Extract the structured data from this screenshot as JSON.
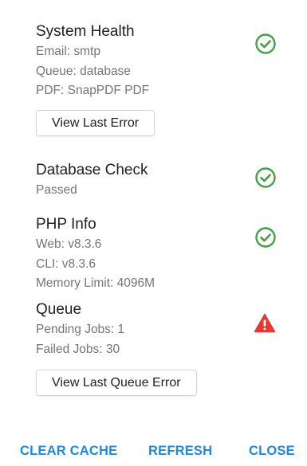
{
  "colors": {
    "ok": "#43a047",
    "warn": "#e53935",
    "accent": "#1e88e5"
  },
  "system_health": {
    "title": "System Health",
    "lines": [
      "Email: smtp",
      "Queue: database",
      "PDF: SnapPDF PDF"
    ],
    "icon": "check-circle-icon",
    "button_label": "View Last Error"
  },
  "database_check": {
    "title": "Database Check",
    "lines": [
      "Passed"
    ],
    "icon": "check-circle-icon"
  },
  "php_info": {
    "title": "PHP Info",
    "lines": [
      "Web: v8.3.6",
      "CLI: v8.3.6",
      "Memory Limit: 4096M"
    ],
    "icon": "check-circle-icon"
  },
  "queue": {
    "title": "Queue",
    "lines": [
      "Pending Jobs: 1",
      "Failed Jobs: 30"
    ],
    "icon": "warning-triangle-icon",
    "button_label": "View Last Queue Error"
  },
  "footer": {
    "clear_cache": "CLEAR CACHE",
    "refresh": "REFRESH",
    "close": "CLOSE"
  }
}
